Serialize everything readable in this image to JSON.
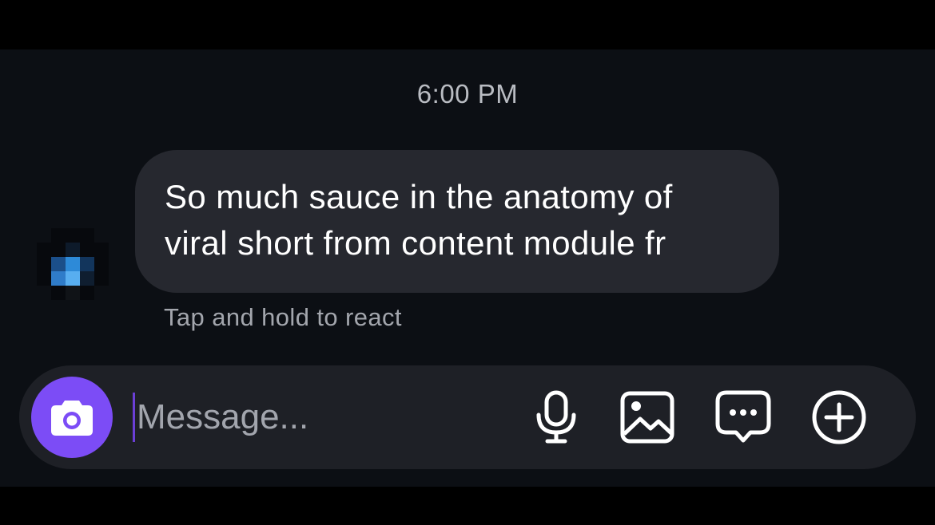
{
  "chat": {
    "timestamp": "6:00 PM",
    "message": {
      "line1": "So much sauce in the anatomy of",
      "line2": "viral short from content module fr"
    },
    "react_hint": "Tap and hold to react"
  },
  "composer": {
    "placeholder": "Message...",
    "icons": {
      "camera": "camera-icon",
      "microphone": "microphone-icon",
      "gallery": "image-icon",
      "stickers": "chat-bubble-icon",
      "more": "plus-icon"
    }
  },
  "colors": {
    "background": "#0c0f14",
    "bubble": "#26282f",
    "composer": "#1e2026",
    "accent": "#7c4cf6"
  }
}
